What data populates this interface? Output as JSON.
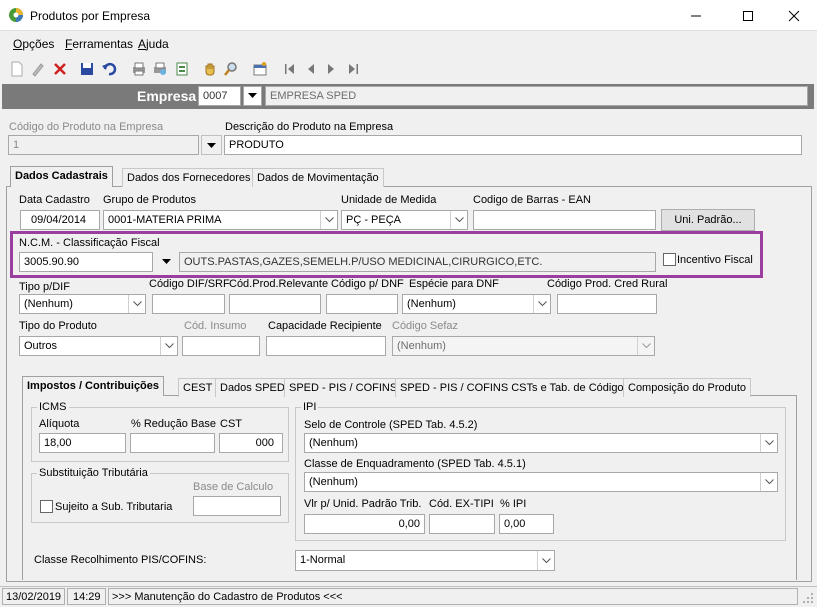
{
  "window": {
    "title": "Produtos por Empresa",
    "minimize_icon": "minimize-icon",
    "maximize_icon": "maximize-icon",
    "close_icon": "close-icon"
  },
  "menu": {
    "items": [
      {
        "label": "Opções",
        "underline": "O",
        "rest": "pções"
      },
      {
        "label": "Ferramentas",
        "underline": "F",
        "rest": "erramentas"
      },
      {
        "label": "Ajuda",
        "underline": "A",
        "rest": "juda"
      }
    ]
  },
  "toolbar": {
    "icons": [
      "new-icon",
      "edit-icon",
      "delete-icon",
      "save-icon",
      "undo-icon",
      "print-icon",
      "print-preview-icon",
      "export-icon",
      "hand-icon",
      "search-icon",
      "report-icon",
      "first-icon",
      "prev-icon",
      "next-icon",
      "last-icon"
    ]
  },
  "empresa": {
    "label": "Empresa",
    "code": "0007",
    "name": "EMPRESA SPED"
  },
  "produto": {
    "codigo_label": "Código do Produto na Empresa",
    "codigo_value": "1",
    "descricao_label": "Descrição do Produto na Empresa",
    "descricao_value": "PRODUTO"
  },
  "tabs": {
    "main": [
      "Dados Cadastrais",
      "Dados dos Fornecedores",
      "Dados de Movimentação"
    ],
    "sub": [
      "Impostos / Contribuições",
      "CEST",
      "Dados SPED",
      "SPED - PIS / COFINS",
      "SPED - PIS / COFINS CSTs e Tab. de Códigos",
      "Composição do Produto"
    ]
  },
  "cadastro": {
    "data_label": "Data Cadastro",
    "data_value": "09/04/2014",
    "grupo_label": "Grupo de Produtos",
    "grupo_value": "0001-MATERIA PRIMA",
    "unidade_label": "Unidade de Medida",
    "unidade_value": "PÇ - PEÇA",
    "ean_label": "Codigo de Barras - EAN",
    "ean_value": "",
    "uni_padrao_button": "Uni. Padrão...",
    "ncm_label": "N.C.M. -  Classificação Fiscal",
    "ncm_code": "3005.90.90",
    "ncm_desc": "OUTS.PASTAS,GAZES,SEMELH.P/USO MEDICINAL,CIRURGICO,ETC.",
    "incentivo_label": "Incentivo Fiscal",
    "tipo_dif_label": "Tipo p/DIF",
    "tipo_dif_value": "(Nenhum)",
    "codigo_dif_label": "Código DIF/SRF",
    "cod_prod_rel_label": "Cód.Prod.Relevante",
    "codigo_dnf_label": "Código p/ DNF",
    "especie_dnf_label": "Espécie para DNF",
    "especie_dnf_value": "(Nenhum)",
    "cred_rural_label": "Código Prod. Cred Rural",
    "tipo_produto_label": "Tipo do Produto",
    "tipo_produto_value": "Outros",
    "cod_insumo_label": "Cód. Insumo",
    "capacidade_label": "Capacidade Recipiente",
    "codigo_sefaz_label": "Código Sefaz",
    "codigo_sefaz_value": "(Nenhum)"
  },
  "icms": {
    "title": "ICMS",
    "aliquota_label": "Alíquota",
    "aliquota_value": "18,00",
    "reducao_label": "% Redução Base",
    "reducao_value": "",
    "cst_label": "CST",
    "cst_value": "000"
  },
  "subst": {
    "title": "Substituição Tributária",
    "base_label": "Base de Calculo",
    "sujeito_label": "Sujeito a Sub. Tributaria"
  },
  "ipi": {
    "title": "IPI",
    "selo_label": "Selo de Controle (SPED Tab. 4.5.2)",
    "selo_value": "(Nenhum)",
    "classe_label": "Classe de Enquadramento (SPED Tab. 4.5.1)",
    "classe_value": "(Nenhum)",
    "vlr_label": "Vlr p/ Unid. Padrão Trib.",
    "vlr_value": "0,00",
    "ex_tipi_label": "Cód. EX-TIPI",
    "ex_tipi_value": "",
    "pct_ipi_label": "% IPI",
    "pct_ipi_value": "0,00"
  },
  "pis": {
    "label": "Classe Recolhimento PIS/COFINS:",
    "value": "1-Normal"
  },
  "status": {
    "date": "13/02/2019",
    "time": "14:29",
    "message": ">>> Manutenção do Cadastro de Produtos <<<"
  },
  "colors": {
    "highlight_border": "#9a3fa0",
    "empresa_bar": "#7a7a7a"
  }
}
